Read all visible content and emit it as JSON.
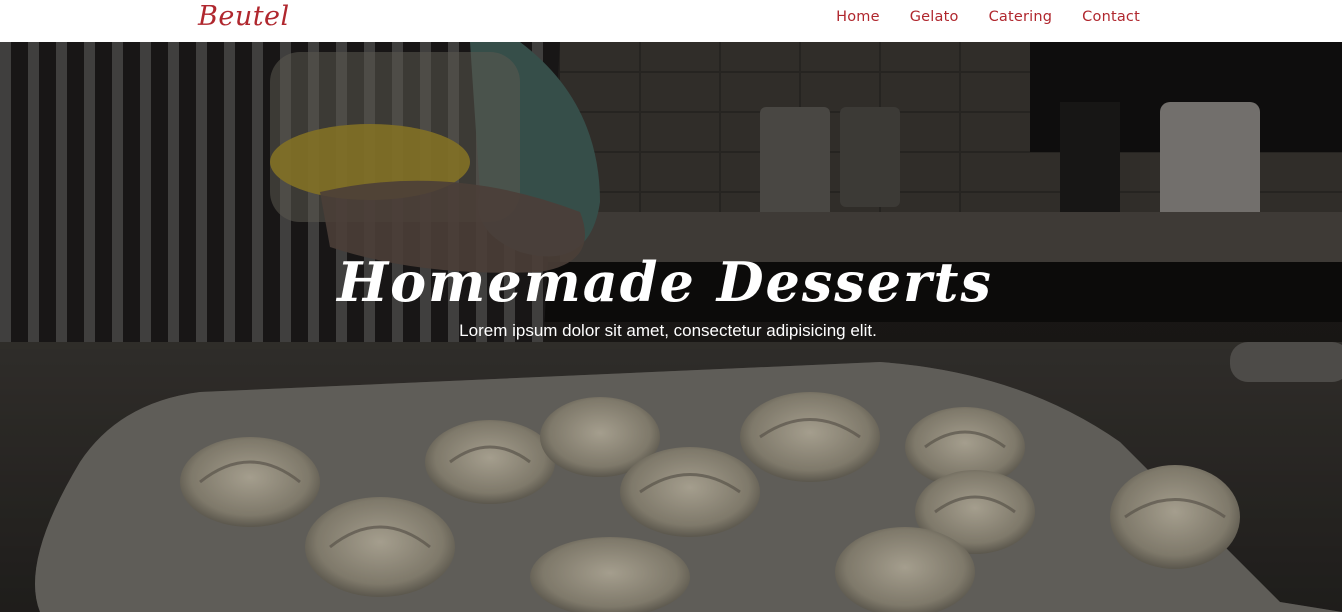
{
  "nav": {
    "brand": "Beutel",
    "links": [
      {
        "label": "Home"
      },
      {
        "label": "Gelato"
      },
      {
        "label": "Catering"
      },
      {
        "label": "Contact"
      }
    ]
  },
  "hero": {
    "title": "Homemade Desserts",
    "subtitle": "Lorem ipsum dolor sit amet, consectetur adipisicing elit.",
    "background": "video-still-croissants-icon"
  },
  "colors": {
    "accent": "#b0272e",
    "navbar_bg": "#ffffff",
    "hero_text": "#ffffff"
  }
}
